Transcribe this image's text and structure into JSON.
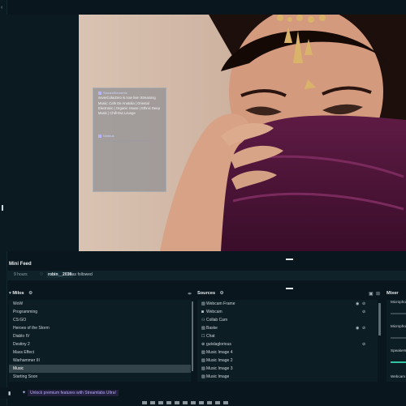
{
  "chat": {
    "messages": [
      {
        "user": "StreamElements",
        "text": "neverCokeZero is now live! Streaming Music: Cafe De Anatolia | Oriental Electronic | Organic House | Ethnic Deep Music | Chill-Out Lounge"
      },
      {
        "user": "Nimbus",
        "text": "· · · · · · · · · · · · · · · · · · · · · · · · · ·"
      }
    ]
  },
  "mini_feed": {
    "title": "Mini Feed",
    "item": {
      "time": "9 hours",
      "user": "robin__2030",
      "action": "has followed"
    }
  },
  "scenes": {
    "title": "Milos",
    "items": [
      "WoW",
      "Programming",
      "CS:GO",
      "Heroes of the Storm",
      "Diablo IV",
      "Destiny 2",
      "Mass Effect",
      "Warhammer III",
      "Music",
      "Starting Soon"
    ],
    "selected": "Music"
  },
  "sources": {
    "title": "Sources",
    "items": [
      {
        "name": "Webcam Frame",
        "icon": "image-icon",
        "hidden": true,
        "locked": true
      },
      {
        "name": "Webcam",
        "icon": "webcam-icon",
        "hidden": false,
        "locked": true
      },
      {
        "name": "Collab Cam",
        "icon": "collab-icon",
        "hidden": false,
        "locked": false
      },
      {
        "name": "Baske",
        "icon": "image-icon",
        "hidden": true,
        "locked": true
      },
      {
        "name": "Chat",
        "icon": "chat-icon",
        "hidden": false,
        "locked": false
      },
      {
        "name": "gutslaglorious",
        "icon": "globe-icon",
        "hidden": false,
        "locked": true
      },
      {
        "name": "Music Image 4",
        "icon": "image-icon",
        "hidden": false,
        "locked": false
      },
      {
        "name": "Music Image 2",
        "icon": "image-icon",
        "hidden": false,
        "locked": false
      },
      {
        "name": "Music Image 3",
        "icon": "image-icon",
        "hidden": false,
        "locked": false
      },
      {
        "name": "Music Image",
        "icon": "image-icon",
        "hidden": false,
        "locked": false
      }
    ]
  },
  "mixer": {
    "title": "Mixer",
    "channels": [
      {
        "label": "Microphone",
        "level": 0.0
      },
      {
        "label": "Microphone",
        "level": 0.0
      },
      {
        "label": "Speakers",
        "level": 0.85
      },
      {
        "label": "Webcam",
        "level": 0.0
      }
    ]
  },
  "footer": {
    "promo": "Unlock premium features with Streamlabs Ultra!"
  },
  "colors": {
    "accent": "#31c3a2",
    "ultra": "#b3adff",
    "background": "#09161d"
  }
}
